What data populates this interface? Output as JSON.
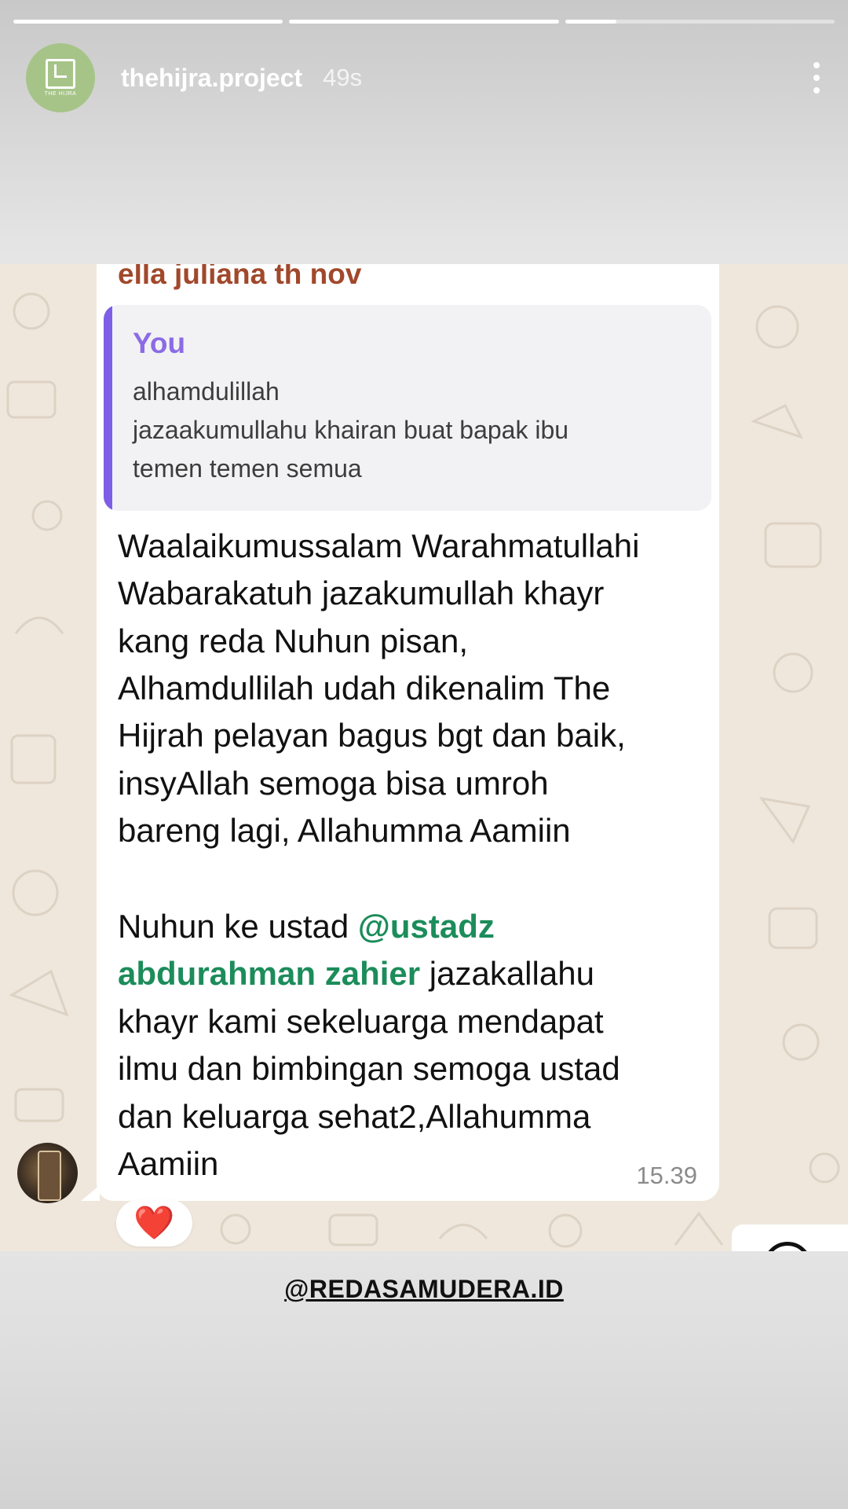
{
  "story": {
    "progress": [
      1.0,
      1.0,
      0.19
    ],
    "account": {
      "username": "thehijra.project",
      "time_ago": "49s",
      "logo_text": "THE HIJRA"
    }
  },
  "chat": {
    "sender_name": "ella juliana th nov",
    "quote": {
      "author": "You",
      "lines": [
        "alhamdulillah",
        "jazaakumullahu khairan buat bapak ibu",
        "temen temen semua"
      ]
    },
    "message": {
      "paragraph1": [
        "Waalaikumussalam Warahmatullahi",
        "Wabarakatuh jazakumullah khayr",
        "kang reda Nuhun pisan,",
        "Alhamdullilah udah dikenalim The",
        "Hijrah pelayan bagus bgt dan baik,",
        "insyAllah semoga bisa umroh",
        "bareng lagi, Allahumma Aamiin"
      ],
      "line_p2_1_prefix": "Nuhun ke ustad ",
      "mention_part1": "@ustadz",
      "mention_part2": "abdurahman zahier",
      "line_p2_2_suffix": "  jazakallahu",
      "paragraph2_rest": [
        "khayr kami sekeluarga mendapat",
        "ilmu dan bimbingan semoga ustad",
        "dan keluarga sehat2,Allahumma",
        "Aamiin"
      ],
      "time": "15.39"
    },
    "reaction": "❤️"
  },
  "watermark": "@REDASAMUDERA.ID",
  "colors": {
    "sender": "#a1482b",
    "quote_accent": "#7d5ee6",
    "mention": "#1c8c5a",
    "chat_bg": "#efe7dc"
  }
}
